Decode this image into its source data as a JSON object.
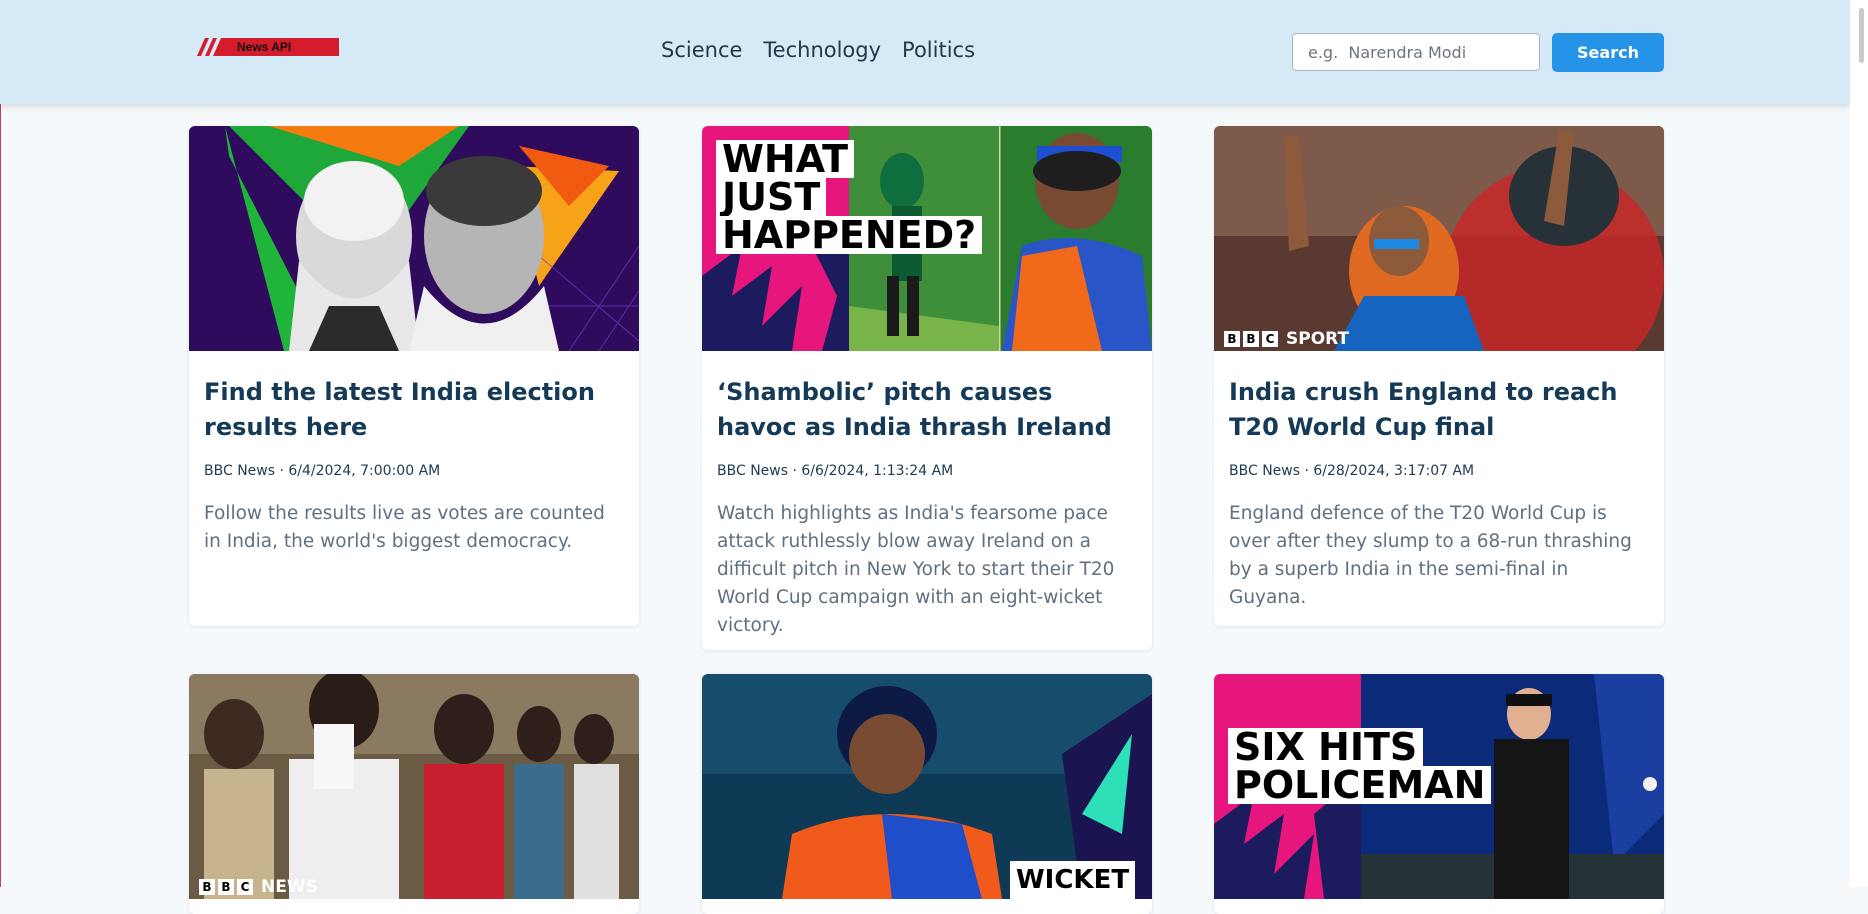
{
  "header": {
    "logo_text": "News API",
    "nav": [
      "Science",
      "Technology",
      "Politics"
    ],
    "search": {
      "placeholder": "e.g.  Narendra Modi",
      "value": "",
      "button_label": "Search"
    }
  },
  "articles": [
    {
      "title": "Find the latest India election results here",
      "meta": "BBC News · 6/4/2024, 7:00:00 AM",
      "description": "Follow the results live as votes are counted in India, the world's biggest democracy."
    },
    {
      "title": "‘Shambolic’ pitch causes havoc as India thrash Ireland",
      "meta": "BBC News · 6/6/2024, 1:13:24 AM",
      "description": "Watch highlights as India's fearsome pace attack ruthlessly blow away Ireland on a difficult pitch in New York to start their T20 World Cup campaign with an eight-wicket victory.",
      "image_overlay": [
        "WHAT",
        "JUST",
        "HAPPENED?"
      ]
    },
    {
      "title": "India crush England to reach T20 World Cup final",
      "meta": "BBC News · 6/28/2024, 3:17:07 AM",
      "description": "England defence of the T20 World Cup is over after they slump to a 68-run thrashing by a superb India in the semi-final in Guyana.",
      "image_overlay": "SPORT"
    },
    {
      "image_overlay": "NEWS"
    },
    {
      "image_overlay": "WICKET"
    },
    {
      "image_overlay": [
        "SIX HITS",
        "POLICEMAN"
      ]
    }
  ]
}
